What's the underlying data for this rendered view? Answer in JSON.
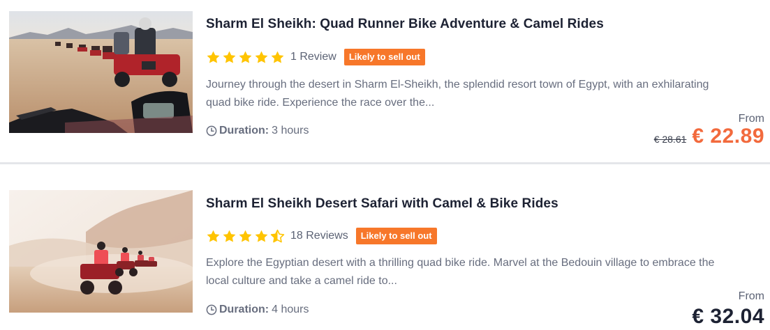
{
  "listings": [
    {
      "image_alt": "Quad bikes riding in a line across the desert",
      "title": "Sharm El Sheikh: Quad Runner Bike Adventure & Camel Rides",
      "rating": 5,
      "reviews": "1 Review",
      "badge": "Likely to sell out",
      "description": "Journey through the desert in Sharm El-Sheikh, the splendid resort town of Egypt, with an exhilarating quad bike ride. Experience the race over the...",
      "duration_label": "Duration:",
      "duration_value": "3 hours",
      "from_label": "From",
      "old_price": "€ 28.61",
      "price": "€ 22.89"
    },
    {
      "image_alt": "Quad bikes kicking up dust in a desert valley",
      "title": "Sharm El Sheikh Desert Safari with Camel & Bike Rides",
      "rating": 4.5,
      "reviews": "18 Reviews",
      "badge": "Likely to sell out",
      "description": "Explore the Egyptian desert with a thrilling quad bike ride. Marvel at the Bedouin village to embrace the local culture and take a camel ride to...",
      "duration_label": "Duration:",
      "duration_value": "4 hours",
      "from_label": "From",
      "old_price": "",
      "price": "€ 32.04"
    }
  ],
  "colors": {
    "star": "#ffc400",
    "badge": "#f7772a",
    "sale_price": "#f26a3d",
    "title": "#1d2233",
    "muted_text": "#676d7e"
  },
  "icons": {
    "star": "star-icon",
    "half_star": "half-star-icon",
    "duration": "clock-icon"
  }
}
